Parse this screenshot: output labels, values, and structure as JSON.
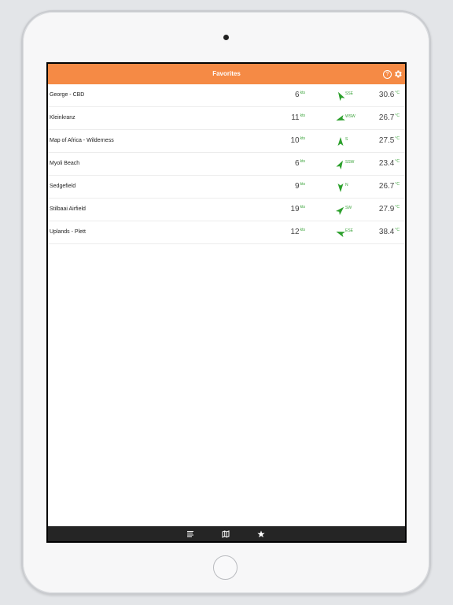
{
  "header": {
    "title": "Favorites",
    "help_glyph": "?",
    "icons": [
      "help-icon",
      "gear-icon"
    ]
  },
  "units": {
    "speed": "kts",
    "temp": "°C"
  },
  "colors": {
    "accent": "#f58a45",
    "arrow": "#2ca02c",
    "tabbar": "#252525"
  },
  "favorites": [
    {
      "name": "George - CBD",
      "speed": "6",
      "direction": "SSE",
      "temp": "30.6"
    },
    {
      "name": "Kleinkranz",
      "speed": "11",
      "direction": "WSW",
      "temp": "26.7"
    },
    {
      "name": "Map of Africa - Wilderness",
      "speed": "10",
      "direction": "S",
      "temp": "27.5"
    },
    {
      "name": "Myoli Beach",
      "speed": "6",
      "direction": "SSW",
      "temp": "23.4"
    },
    {
      "name": "Sedgefield",
      "speed": "9",
      "direction": "N",
      "temp": "26.7"
    },
    {
      "name": "Stilbaai Airfield",
      "speed": "19",
      "direction": "SW",
      "temp": "27.9"
    },
    {
      "name": "Uplands - Plett",
      "speed": "12",
      "direction": "ESE",
      "temp": "38.4"
    }
  ],
  "tabbar": {
    "tabs": [
      {
        "icon": "list-icon"
      },
      {
        "icon": "map-icon"
      },
      {
        "icon": "star-icon"
      }
    ]
  }
}
